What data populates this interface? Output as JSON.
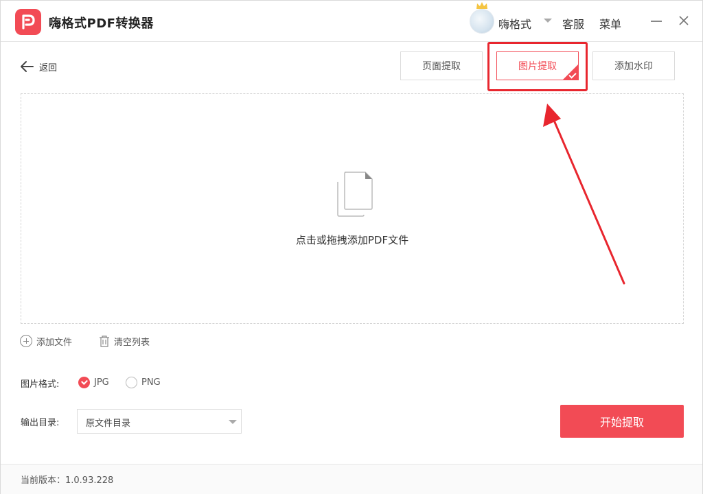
{
  "app": {
    "title": "嗨格式PDF转换器",
    "brand_color": "#f24b55",
    "logo_icon": "app-logo-icon"
  },
  "titlebar": {
    "username": "嗨格式",
    "service_label": "客服",
    "menu_label": "菜单"
  },
  "nav": {
    "back_label": "返回"
  },
  "tabs": [
    {
      "label": "页面提取",
      "active": false
    },
    {
      "label": "图片提取",
      "active": true
    },
    {
      "label": "添加水印",
      "active": false
    }
  ],
  "dropzone": {
    "text": "点击或拖拽添加PDF文件",
    "icon": "document-icon"
  },
  "file_actions": {
    "add_file_label": "添加文件",
    "clear_list_label": "清空列表"
  },
  "format": {
    "label": "图片格式:",
    "options": [
      {
        "label": "JPG",
        "selected": true
      },
      {
        "label": "PNG",
        "selected": false
      }
    ]
  },
  "output": {
    "label": "输出目录:",
    "selected": "原文件目录"
  },
  "actions": {
    "start_label": "开始提取"
  },
  "footer": {
    "version_text": "当前版本：1.0.93.228"
  },
  "annotation": {
    "color": "#e8262e"
  }
}
